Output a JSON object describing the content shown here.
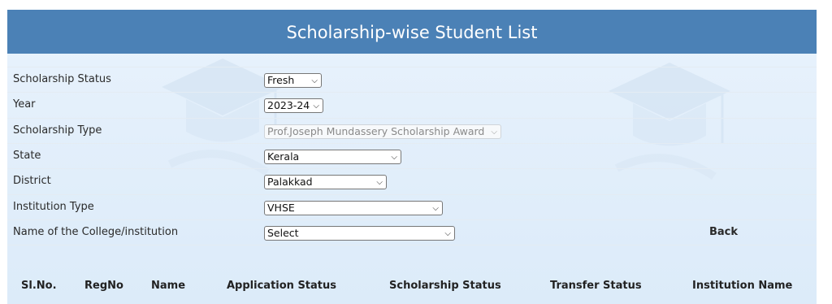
{
  "header": {
    "title": "Scholarship-wise Student List"
  },
  "form": {
    "scholarship_status": {
      "label": "Scholarship Status",
      "value": "Fresh"
    },
    "year": {
      "label": "Year",
      "value": "2023-24"
    },
    "scholarship_type": {
      "label": "Scholarship Type",
      "value": "Prof.Joseph Mundassery Scholarship Award"
    },
    "state": {
      "label": "State",
      "value": "Kerala"
    },
    "district": {
      "label": "District",
      "value": "Palakkad"
    },
    "institution_type": {
      "label": "Institution Type",
      "value": "VHSE"
    },
    "college": {
      "label": "Name of the College/institution",
      "value": "Select"
    },
    "back_label": "Back"
  },
  "table": {
    "columns": [
      "Sl.No.",
      "RegNo",
      "Name",
      "Application Status",
      "Scholarship Status",
      "Transfer Status",
      "Institution Name"
    ]
  },
  "icons": {
    "dropdown": "chevron-down-icon",
    "watermark": "graduation-cap-icon"
  },
  "colors": {
    "header_bg": "#4b81b6",
    "panel_bg": "#e3effb"
  }
}
